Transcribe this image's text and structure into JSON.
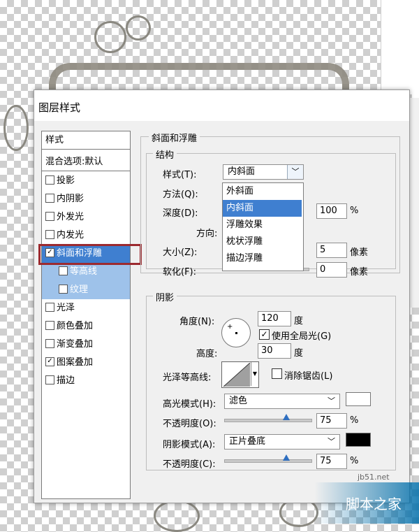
{
  "dialog": {
    "title": "图层样式",
    "left_header": "样式",
    "blend_item": "混合选项:默认",
    "styles": [
      {
        "label": "投影",
        "checked": false
      },
      {
        "label": "内阴影",
        "checked": false
      },
      {
        "label": "外发光",
        "checked": false
      },
      {
        "label": "内发光",
        "checked": false
      },
      {
        "label": "斜面和浮雕",
        "checked": true
      },
      {
        "label": "等高线",
        "checked": false
      },
      {
        "label": "纹理",
        "checked": false
      },
      {
        "label": "光泽",
        "checked": false
      },
      {
        "label": "颜色叠加",
        "checked": false
      },
      {
        "label": "渐变叠加",
        "checked": false
      },
      {
        "label": "图案叠加",
        "checked": true
      },
      {
        "label": "描边",
        "checked": false
      }
    ]
  },
  "bevel": {
    "section_title": "斜面和浮雕",
    "structure_title": "结构",
    "style_label": "样式(T):",
    "style_value": "内斜面",
    "method_label": "方法(Q):",
    "depth_label": "深度(D):",
    "depth_value": "100",
    "depth_unit": "%",
    "direction_label": "方向:",
    "size_label": "大小(Z):",
    "size_value": "5",
    "size_unit": "像素",
    "soften_label": "软化(F):",
    "soften_value": "0",
    "soften_unit": "像素",
    "dropdown_options": [
      "外斜面",
      "内斜面",
      "浮雕效果",
      "枕状浮雕",
      "描边浮雕"
    ],
    "dropdown_selected": 1
  },
  "shading": {
    "title": "阴影",
    "angle_label": "角度(N):",
    "angle_value": "120",
    "angle_unit": "度",
    "global_light_label": "使用全局光(G)",
    "altitude_label": "高度:",
    "altitude_value": "30",
    "altitude_unit": "度",
    "gloss_label": "光泽等高线:",
    "antialias_label": "消除锯齿(L)",
    "highlight_label": "高光模式(H):",
    "highlight_value": "滤色",
    "highlight_color": "#ffffff",
    "opacity1_label": "不透明度(O):",
    "opacity1_value": "75",
    "opacity1_unit": "%",
    "shadow_label": "阴影模式(A):",
    "shadow_value": "正片叠底",
    "shadow_color": "#000000",
    "opacity2_label": "不透明度(C):",
    "opacity2_value": "75",
    "opacity2_unit": "%"
  },
  "watermark": {
    "site": "jb51.net",
    "brand": "脚本之家"
  },
  "colors": {
    "selection": "#3f7fd0",
    "sub_selection": "#9ec2ea",
    "highlight_box": "#9c2a2f"
  }
}
